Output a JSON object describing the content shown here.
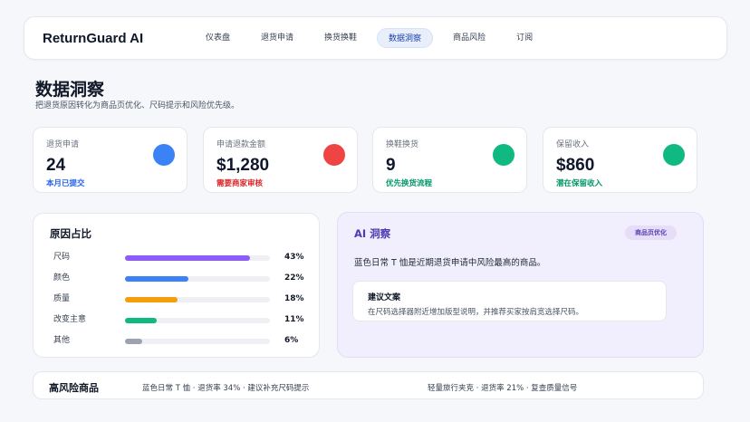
{
  "app": {
    "title": "ReturnGuard AI"
  },
  "nav": {
    "tabs": [
      {
        "label": "仪表盘"
      },
      {
        "label": "退货申请"
      },
      {
        "label": "换货换鞋"
      },
      {
        "label": "数据洞察"
      },
      {
        "label": "商品风险"
      },
      {
        "label": "订阅"
      }
    ],
    "active_index": 3
  },
  "header": {
    "title": "数据洞察",
    "subtitle": "把退货原因转化为商品页优化、尺码提示和风险优先级。"
  },
  "stats": [
    {
      "label": "退货申请",
      "value": "24",
      "note": "本月已提交",
      "note_color": "#2563eb",
      "dot_color": "#3b82f6"
    },
    {
      "label": "申请退款金额",
      "value": "$1,280",
      "note": "需要商家审核",
      "note_color": "#dc2626",
      "dot_color": "#ef4444"
    },
    {
      "label": "换鞋换货",
      "value": "9",
      "note": "优先换货流程",
      "note_color": "#059669",
      "dot_color": "#10b981"
    },
    {
      "label": "保留收入",
      "value": "$860",
      "note": "潜在保留收入",
      "note_color": "#059669",
      "dot_color": "#10b981"
    }
  ],
  "reasons": {
    "title": "原因占比",
    "items": [
      {
        "label": "尺码",
        "percent": 43,
        "percent_label": "43%",
        "color": "#8b5cf6"
      },
      {
        "label": "颜色",
        "percent": 22,
        "percent_label": "22%",
        "color": "#3b82f6"
      },
      {
        "label": "质量",
        "percent": 18,
        "percent_label": "18%",
        "color": "#f59e0b"
      },
      {
        "label": "改变主意",
        "percent": 11,
        "percent_label": "11%",
        "color": "#10b981"
      },
      {
        "label": "其他",
        "percent": 6,
        "percent_label": "6%",
        "color": "#9ca3af"
      }
    ]
  },
  "ai_insight": {
    "title": "AI 洞察",
    "badge": "商品页优化",
    "text": "蓝色日常 T 恤是近期退货申请中风险最高的商品。",
    "suggestion_title": "建议文案",
    "suggestion_text": "在尺码选择器附近增加版型说明，并推荐买家按肩宽选择尺码。"
  },
  "high_risk": {
    "title": "高风险商品",
    "items": [
      {
        "text": "蓝色日常 T 恤 · 退货率 34% · 建议补充尺码提示"
      },
      {
        "text": "轻量旅行夹克 · 退货率 21% · 复查质量信号"
      }
    ]
  }
}
